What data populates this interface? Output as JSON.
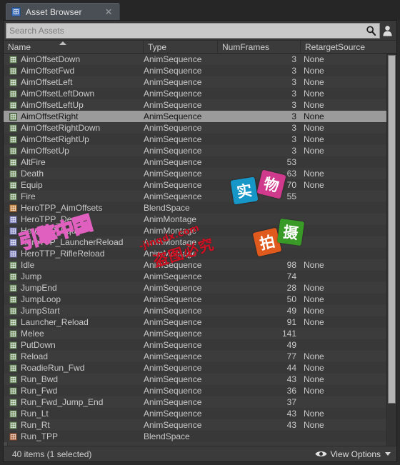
{
  "window": {
    "tab_label": "Asset Browser",
    "tab_icon": "grid-icon",
    "close_icon": "close-icon"
  },
  "search": {
    "placeholder": "Search Assets",
    "value": "",
    "search_icon": "search-icon",
    "user_icon": "person-icon"
  },
  "columns": [
    {
      "key": "name",
      "label": "Name",
      "sorted": true,
      "sort_dir": "asc"
    },
    {
      "key": "type",
      "label": "Type",
      "sorted": false
    },
    {
      "key": "numframes",
      "label": "NumFrames",
      "sorted": false
    },
    {
      "key": "retarget",
      "label": "RetargetSource",
      "sorted": false
    }
  ],
  "rows": [
    {
      "name": "AimOffsetDown",
      "type": "AnimSequence",
      "numframes": "3",
      "retarget": "None",
      "icon": "anim-sequence-icon",
      "selected": false
    },
    {
      "name": "AimOffsetFwd",
      "type": "AnimSequence",
      "numframes": "3",
      "retarget": "None",
      "icon": "anim-sequence-icon",
      "selected": false
    },
    {
      "name": "AimOffsetLeft",
      "type": "AnimSequence",
      "numframes": "3",
      "retarget": "None",
      "icon": "anim-sequence-icon",
      "selected": false
    },
    {
      "name": "AimOffsetLeftDown",
      "type": "AnimSequence",
      "numframes": "3",
      "retarget": "None",
      "icon": "anim-sequence-icon",
      "selected": false
    },
    {
      "name": "AimOffsetLeftUp",
      "type": "AnimSequence",
      "numframes": "3",
      "retarget": "None",
      "icon": "anim-sequence-icon",
      "selected": false
    },
    {
      "name": "AimOffsetRight",
      "type": "AnimSequence",
      "numframes": "3",
      "retarget": "None",
      "icon": "anim-sequence-icon",
      "selected": true
    },
    {
      "name": "AimOffsetRightDown",
      "type": "AnimSequence",
      "numframes": "3",
      "retarget": "None",
      "icon": "anim-sequence-icon",
      "selected": false
    },
    {
      "name": "AimOffsetRightUp",
      "type": "AnimSequence",
      "numframes": "3",
      "retarget": "None",
      "icon": "anim-sequence-icon",
      "selected": false
    },
    {
      "name": "AimOffsetUp",
      "type": "AnimSequence",
      "numframes": "3",
      "retarget": "None",
      "icon": "anim-sequence-icon",
      "selected": false
    },
    {
      "name": "AltFire",
      "type": "AnimSequence",
      "numframes": "53",
      "retarget": "",
      "icon": "anim-sequence-icon",
      "selected": false
    },
    {
      "name": "Death",
      "type": "AnimSequence",
      "numframes": "63",
      "retarget": "None",
      "icon": "anim-sequence-icon",
      "selected": false
    },
    {
      "name": "Equip",
      "type": "AnimSequence",
      "numframes": "70",
      "retarget": "None",
      "icon": "anim-sequence-icon",
      "selected": false
    },
    {
      "name": "Fire",
      "type": "AnimSequence",
      "numframes": "55",
      "retarget": "",
      "icon": "anim-sequence-icon",
      "selected": false
    },
    {
      "name": "HeroTPP_AimOffsets",
      "type": "BlendSpace",
      "numframes": "",
      "retarget": "",
      "icon": "blend-space-icon",
      "selected": false
    },
    {
      "name": "HeroTPP_Death",
      "type": "AnimMontage",
      "numframes": "",
      "retarget": "",
      "icon": "anim-montage-icon",
      "selected": false
    },
    {
      "name": "HeroTPP_Equip",
      "type": "AnimMontage",
      "numframes": "",
      "retarget": "",
      "icon": "anim-montage-icon",
      "selected": false
    },
    {
      "name": "HeroTTP_LauncherReload",
      "type": "AnimMontage",
      "numframes": "",
      "retarget": "",
      "icon": "anim-montage-icon",
      "selected": false
    },
    {
      "name": "HeroTTP_RifleReload",
      "type": "AnimMontage",
      "numframes": "",
      "retarget": "",
      "icon": "anim-montage-icon",
      "selected": false
    },
    {
      "name": "Idle",
      "type": "AnimSequence",
      "numframes": "98",
      "retarget": "None",
      "icon": "anim-sequence-icon",
      "selected": false
    },
    {
      "name": "Jump",
      "type": "AnimSequence",
      "numframes": "74",
      "retarget": "",
      "icon": "anim-sequence-icon",
      "selected": false
    },
    {
      "name": "JumpEnd",
      "type": "AnimSequence",
      "numframes": "28",
      "retarget": "None",
      "icon": "anim-sequence-icon",
      "selected": false
    },
    {
      "name": "JumpLoop",
      "type": "AnimSequence",
      "numframes": "50",
      "retarget": "None",
      "icon": "anim-sequence-icon",
      "selected": false
    },
    {
      "name": "JumpStart",
      "type": "AnimSequence",
      "numframes": "49",
      "retarget": "None",
      "icon": "anim-sequence-icon",
      "selected": false
    },
    {
      "name": "Launcher_Reload",
      "type": "AnimSequence",
      "numframes": "91",
      "retarget": "None",
      "icon": "anim-sequence-icon",
      "selected": false
    },
    {
      "name": "Melee",
      "type": "AnimSequence",
      "numframes": "141",
      "retarget": "",
      "icon": "anim-sequence-icon",
      "selected": false
    },
    {
      "name": "PutDown",
      "type": "AnimSequence",
      "numframes": "49",
      "retarget": "",
      "icon": "anim-sequence-icon",
      "selected": false
    },
    {
      "name": "Reload",
      "type": "AnimSequence",
      "numframes": "77",
      "retarget": "None",
      "icon": "anim-sequence-icon",
      "selected": false
    },
    {
      "name": "RoadieRun_Fwd",
      "type": "AnimSequence",
      "numframes": "44",
      "retarget": "None",
      "icon": "anim-sequence-icon",
      "selected": false
    },
    {
      "name": "Run_Bwd",
      "type": "AnimSequence",
      "numframes": "43",
      "retarget": "None",
      "icon": "anim-sequence-icon",
      "selected": false
    },
    {
      "name": "Run_Fwd",
      "type": "AnimSequence",
      "numframes": "36",
      "retarget": "None",
      "icon": "anim-sequence-icon",
      "selected": false
    },
    {
      "name": "Run_Fwd_Jump_End",
      "type": "AnimSequence",
      "numframes": "37",
      "retarget": "",
      "icon": "anim-sequence-icon",
      "selected": false
    },
    {
      "name": "Run_Lt",
      "type": "AnimSequence",
      "numframes": "43",
      "retarget": "None",
      "icon": "anim-sequence-icon",
      "selected": false
    },
    {
      "name": "Run_Rt",
      "type": "AnimSequence",
      "numframes": "43",
      "retarget": "None",
      "icon": "anim-sequence-icon",
      "selected": false
    },
    {
      "name": "Run_TPP",
      "type": "BlendSpace",
      "numframes": "",
      "retarget": "",
      "icon": "blend-space-1d-icon",
      "selected": false
    }
  ],
  "status": {
    "items_text": "40 items (1 selected)",
    "view_options_label": "View Options",
    "eye_icon": "eye-icon",
    "caret_icon": "chevron-down-icon"
  },
  "watermark": {
    "tiles": [
      {
        "char": "实",
        "color": "#1796c8"
      },
      {
        "char": "物",
        "color": "#d03a8c"
      },
      {
        "char": "拍",
        "color": "#e05a1e"
      },
      {
        "char": "摄",
        "color": "#3a9a28"
      }
    ],
    "outline_text": "引擎中国",
    "outline_color": "#e060c0",
    "url_text": "-jinqdx.com",
    "cn_text": "盗图必究",
    "red_color": "#cc1122"
  },
  "colors": {
    "window_bg": "#2b2b2b",
    "panel_bg": "#383838",
    "row_bg": "#3c3c3c",
    "selection": "#9b9b9b",
    "text": "#c9c9c9",
    "search_bg": "#c8c8c8"
  }
}
